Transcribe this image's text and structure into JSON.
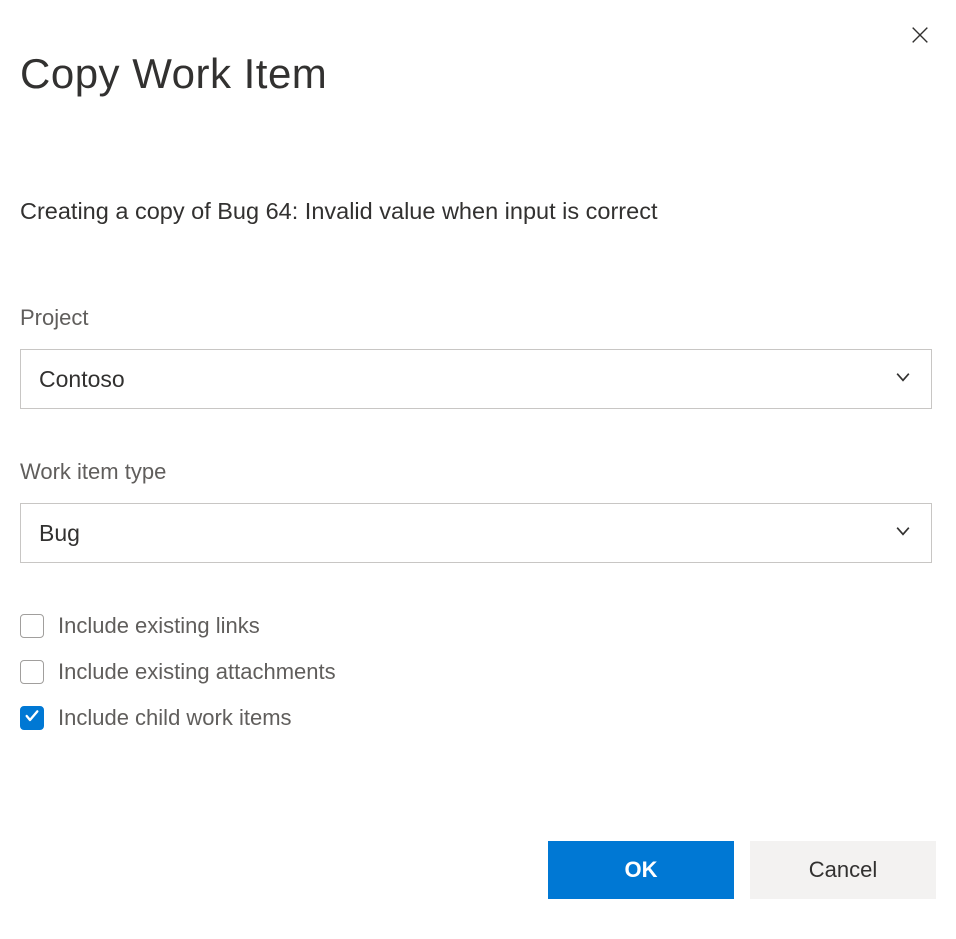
{
  "dialog": {
    "title": "Copy Work Item",
    "subtitle": "Creating a copy of Bug 64: Invalid value when input is correct"
  },
  "fields": {
    "project": {
      "label": "Project",
      "value": "Contoso"
    },
    "work_item_type": {
      "label": "Work item type",
      "value": "Bug"
    }
  },
  "checkboxes": {
    "include_links": {
      "label": "Include existing links",
      "checked": false
    },
    "include_attachments": {
      "label": "Include existing attachments",
      "checked": false
    },
    "include_children": {
      "label": "Include child work items",
      "checked": true
    }
  },
  "buttons": {
    "ok": "OK",
    "cancel": "Cancel"
  }
}
